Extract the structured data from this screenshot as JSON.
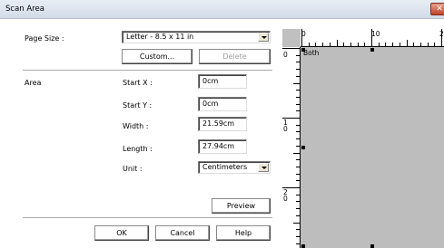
{
  "window": {
    "title": "Scan Area",
    "close_symbol": "✕"
  },
  "page_size": {
    "label": "Page Size :",
    "value": "Letter - 8.5 x 11 in",
    "custom_button": "Custom...",
    "delete_button": "Delete"
  },
  "area": {
    "label": "Area",
    "start_x": {
      "label": "Start X :",
      "value": "0cm"
    },
    "start_y": {
      "label": "Start Y :",
      "value": "0cm"
    },
    "width": {
      "label": "Width :",
      "value": "21.59cm"
    },
    "length": {
      "label": "Length :",
      "value": "27.94cm"
    },
    "unit": {
      "label": "Unit :",
      "value": "Centimeters"
    }
  },
  "buttons": {
    "preview": "Preview",
    "ok": "OK",
    "cancel": "Cancel",
    "help": "Help"
  },
  "preview": {
    "ruler_top_labels": [
      "0",
      "10",
      "2"
    ],
    "ruler_left_labels": [
      "0",
      "1\n0",
      "2\n0"
    ],
    "mode_label": "Both",
    "colors": {
      "canvas": "#bdbdbd",
      "ruler": "#ffffff"
    }
  }
}
